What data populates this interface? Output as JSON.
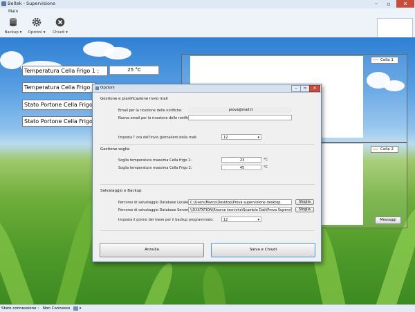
{
  "window": {
    "title": "Beltek - Supervisione"
  },
  "ribbon": {
    "tab": "Main",
    "buttons": [
      {
        "label": "Backup",
        "icon": "database-icon"
      },
      {
        "label": "Opzioni",
        "icon": "gear-icon"
      },
      {
        "label": "Chiudi",
        "icon": "close-circle-icon"
      }
    ]
  },
  "labels": {
    "temp1": "Temperatura Cella Frigo 1 :",
    "temp1_value": "25 °C",
    "temp2": "Temperatura Cella Frigo",
    "portone1": "Stato Portone Cella Frigo",
    "portone2": "Stato Portone Cella Frigo"
  },
  "charts": {
    "legend1": "Cella 1",
    "legend2": "Cella 2",
    "legend1_color": "#a9b4c2",
    "legend2_color": "#f0932b",
    "messaggi_button": "Messaggi"
  },
  "dialog": {
    "title": "Opzioni",
    "section_mail": "Gestione e pianificazione invio mail",
    "email_label": "Email per la ricezione delle notifiche:",
    "email_value": "prova@mail.it",
    "new_email_label": "Nuova email per la ricezione delle notifiche:",
    "new_email_value": "",
    "hour_label": "Imposta l' ora dell'invio giornaliero della mail:",
    "hour_value": "12",
    "section_soglie": "Gestione soglie",
    "soglia1_label": "Soglia temperatura massima Cella frigo 1:",
    "soglia1_value": "23",
    "soglia2_label": "Soglia temperatura massima Cella Frigo 2:",
    "soglia2_value": "45",
    "unit": "°C",
    "section_backup": "Salvataggio e Backup",
    "local_path_label": "Percorso di salvataggio Database Locale:",
    "local_path_value": "C:\\Users\\Marco\\Desktop\\Prova supervisione desktop",
    "server_path_label": "Percorso di salvataggio Database Server:",
    "server_path_value": "\\\\DXSTATION\\Risorse tecniche\\Scambio Dati\\Prova Supervisi",
    "browse_label": "Sfoglia",
    "day_label": "Imposta il giorno del mese per il backup programmato:",
    "day_value": "12",
    "cancel_button": "Annulla",
    "save_button": "Salva e Chiudi"
  },
  "status": {
    "label": "Stato connessione :",
    "value": "Non Connesso"
  }
}
